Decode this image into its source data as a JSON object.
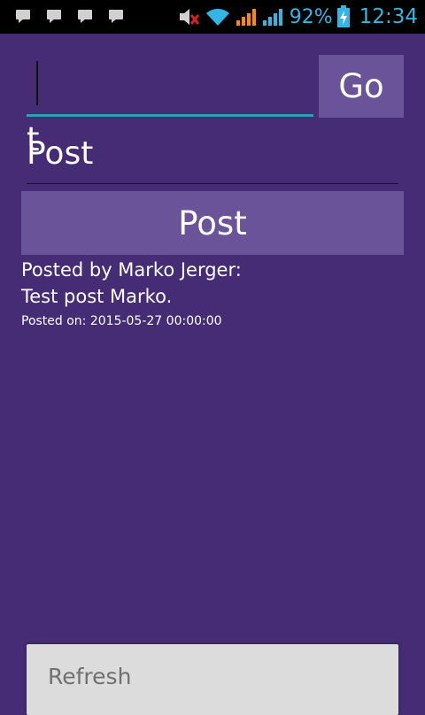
{
  "status_bar": {
    "notification_icons": [
      "chat-icon",
      "chat-icon",
      "chat-icon",
      "chat-icon"
    ],
    "battery_percent": "92%",
    "time": "12:34",
    "accent_color": "#33b5e5"
  },
  "search": {
    "value": "t",
    "go_label": "Go"
  },
  "post_input": {
    "value": "Post"
  },
  "post_button": {
    "label": "Post"
  },
  "posts": [
    {
      "author_line": "Posted by Marko Jerger:",
      "body": "Test post Marko.",
      "date_line": "Posted on: 2015-05-27 00:00:00"
    }
  ],
  "refresh": {
    "label": "Refresh"
  },
  "colors": {
    "background": "#452c74",
    "button": "#6a5398",
    "input_underline": "#2e9fb0"
  }
}
